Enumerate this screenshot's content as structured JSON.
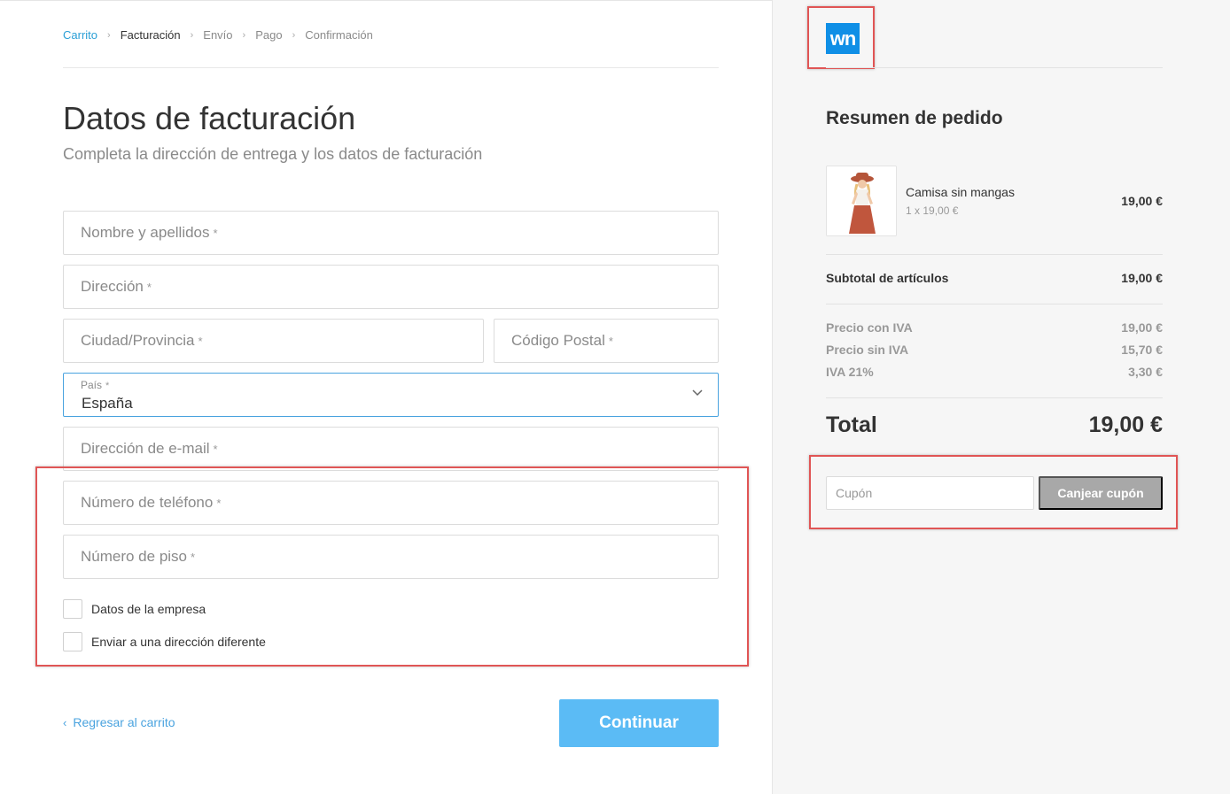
{
  "breadcrumb": {
    "items": [
      "Carrito",
      "Facturación",
      "Envío",
      "Pago",
      "Confirmación"
    ],
    "separator": "›"
  },
  "page": {
    "title": "Datos de facturación",
    "subtitle": "Completa la dirección de entrega y los datos de facturación"
  },
  "form": {
    "name_placeholder": "Nombre y apellidos",
    "address_placeholder": "Dirección",
    "city_placeholder": "Ciudad/Provincia",
    "zip_placeholder": "Código Postal",
    "country_label": "País",
    "country_value": "España",
    "email_placeholder": "Dirección de e-mail",
    "phone_placeholder": "Número de teléfono",
    "floor_placeholder": "Número de piso",
    "required_mark": "*",
    "company_checkbox": "Datos de la empresa",
    "different_address_checkbox": "Enviar a una dirección diferente"
  },
  "actions": {
    "back_icon": "‹",
    "back_label": "Regresar al carrito",
    "continue_label": "Continuar"
  },
  "summary": {
    "logo_text": "wn",
    "title": "Resumen de pedido",
    "product": {
      "name": "Camisa sin mangas",
      "qty_line": "1 x 19,00 €",
      "price": "19,00 €"
    },
    "subtotal_label": "Subtotal de artículos",
    "subtotal_value": "19,00 €",
    "price_with_vat_label": "Precio con IVA",
    "price_with_vat_value": "19,00 €",
    "price_without_vat_label": "Precio sin IVA",
    "price_without_vat_value": "15,70 €",
    "vat_label": "IVA 21%",
    "vat_value": "3,30 €",
    "total_label": "Total",
    "total_value": "19,00 €",
    "coupon_placeholder": "Cupón",
    "redeem_label": "Canjear cupón"
  },
  "colors": {
    "accent": "#4aa3df",
    "continue_bg": "#5bbbf5",
    "highlight_box": "#e05555",
    "logo_bg": "#0f8fe6"
  }
}
